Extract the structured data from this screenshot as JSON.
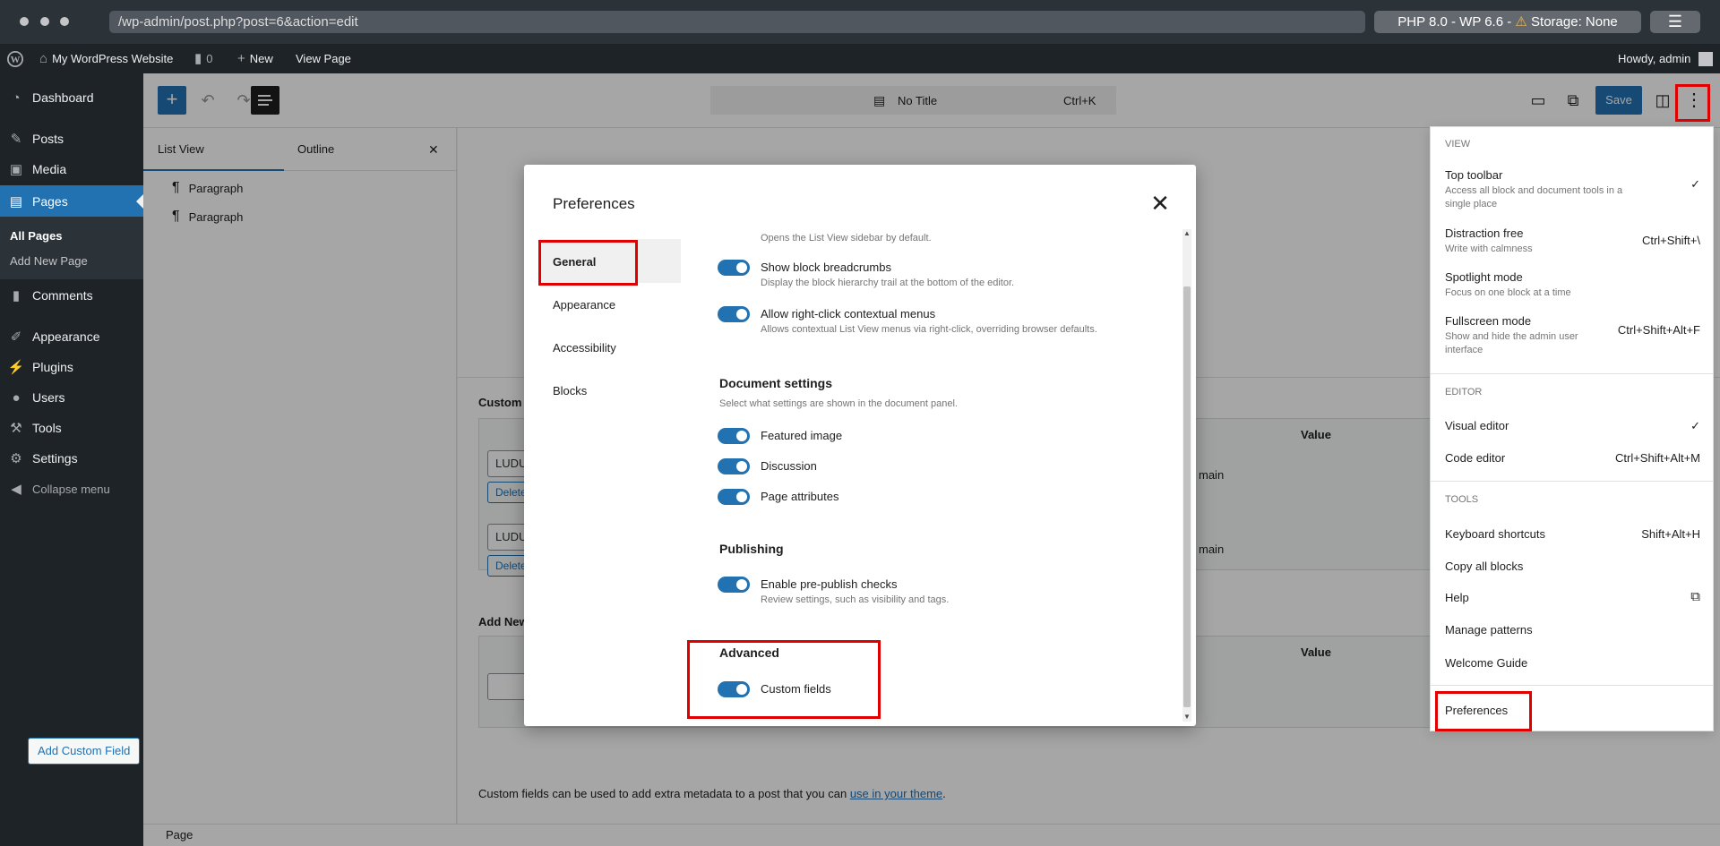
{
  "browser": {
    "url": "/wp-admin/post.php?post=6&action=edit",
    "env_prefix": "PHP 8.0 - WP 6.6 - ",
    "env_warning": "⚠",
    "env_storage": "Storage: None",
    "menu_icon": "☰"
  },
  "adminbar": {
    "site_name": "My WordPress Website",
    "comments_count": "0",
    "new_label": "New",
    "view_page": "View Page",
    "howdy": "Howdy, admin"
  },
  "sidebar": {
    "items": [
      {
        "label": "Dashboard",
        "icon": "dashboard-icon"
      },
      {
        "label": "Posts",
        "icon": "pin-icon"
      },
      {
        "label": "Media",
        "icon": "media-icon"
      },
      {
        "label": "Pages",
        "icon": "pages-icon"
      },
      {
        "label": "Comments",
        "icon": "comment-icon"
      },
      {
        "label": "Appearance",
        "icon": "brush-icon"
      },
      {
        "label": "Plugins",
        "icon": "plug-icon"
      },
      {
        "label": "Users",
        "icon": "user-icon"
      },
      {
        "label": "Tools",
        "icon": "wrench-icon"
      },
      {
        "label": "Settings",
        "icon": "sliders-icon"
      },
      {
        "label": "Collapse menu",
        "icon": "collapse-icon"
      }
    ],
    "submenu": [
      "All Pages",
      "Add New Page"
    ]
  },
  "editor": {
    "command_title": "No Title",
    "command_shortcut": "Ctrl+K",
    "save_label": "Save"
  },
  "listview": {
    "tabs": [
      "List View",
      "Outline"
    ],
    "close": "✕",
    "rows": [
      "Paragraph",
      "Paragraph"
    ]
  },
  "metabox": {
    "custom_title": "Custom",
    "value_header": "Value",
    "row_input_1": "LUDU",
    "row_input_2": "LUDU",
    "delete_1": "Delete",
    "delete_2": "Delete",
    "value_text_1": "main",
    "value_text_2": "main",
    "add_new": "Add New",
    "value_header_2": "Value",
    "add_button": "Add Custom Field",
    "note_text": "Custom fields can be used to add extra metadata to a post that you can ",
    "note_link": "use in your theme",
    "note_end": "."
  },
  "footer": {
    "breadcrumb": "Page"
  },
  "modal": {
    "title": "Preferences",
    "close": "✕",
    "nav": [
      "General",
      "Appearance",
      "Accessibility",
      "Blocks"
    ],
    "top_cut_help": "Opens the List View sidebar by default.",
    "prefs_top": [
      {
        "label": "Show block breadcrumbs",
        "help": "Display the block hierarchy trail at the bottom of the editor."
      },
      {
        "label": "Allow right-click contextual menus",
        "help": "Allows contextual List View menus via right-click, overriding browser defaults."
      }
    ],
    "document_settings": {
      "title": "Document settings",
      "desc": "Select what settings are shown in the document panel.",
      "items": [
        "Featured image",
        "Discussion",
        "Page attributes"
      ]
    },
    "publishing": {
      "title": "Publishing",
      "label": "Enable pre-publish checks",
      "help": "Review settings, such as visibility and tags."
    },
    "advanced": {
      "title": "Advanced",
      "label": "Custom fields"
    }
  },
  "dropdown": {
    "view_group": "VIEW",
    "view_items": [
      {
        "label": "Top toolbar",
        "help": "Access all block and document tools in a single place",
        "shortcut": "✓"
      },
      {
        "label": "Distraction free",
        "help": "Write with calmness",
        "shortcut": "Ctrl+Shift+\\"
      },
      {
        "label": "Spotlight mode",
        "help": "Focus on one block at a time",
        "shortcut": ""
      },
      {
        "label": "Fullscreen mode",
        "help": "Show and hide the admin user interface",
        "shortcut": "Ctrl+Shift+Alt+F"
      }
    ],
    "editor_group": "EDITOR",
    "editor_items": [
      {
        "label": "Visual editor",
        "shortcut": "✓"
      },
      {
        "label": "Code editor",
        "shortcut": "Ctrl+Shift+Alt+M"
      }
    ],
    "tools_group": "TOOLS",
    "tools_items": [
      {
        "label": "Keyboard shortcuts",
        "shortcut": "Shift+Alt+H"
      },
      {
        "label": "Copy all blocks",
        "shortcut": ""
      },
      {
        "label": "Help",
        "shortcut": "⧉"
      },
      {
        "label": "Manage patterns",
        "shortcut": ""
      },
      {
        "label": "Welcome Guide",
        "shortcut": ""
      }
    ],
    "preferences": "Preferences"
  },
  "colors": {
    "accent": "#2271b1",
    "admin_dark": "#1d2327",
    "highlight": "#e00000"
  }
}
